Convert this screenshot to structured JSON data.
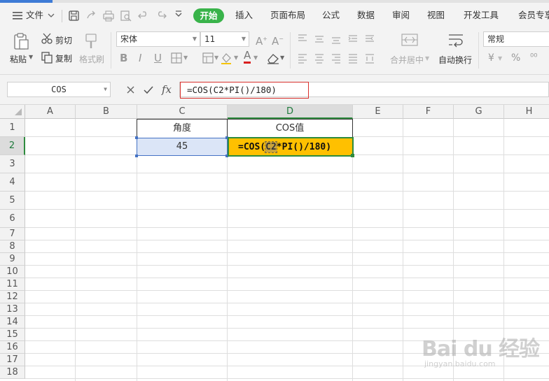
{
  "menu": {
    "file_label": "文件",
    "tabs": [
      "开始",
      "插入",
      "页面布局",
      "公式",
      "数据",
      "审阅",
      "视图",
      "开发工具",
      "会员专享"
    ]
  },
  "ribbon": {
    "paste": "粘贴",
    "cut": "剪切",
    "copy": "复制",
    "format_painter": "格式刷",
    "font_name": "宋体",
    "font_size": "11",
    "merge_center": "合并居中",
    "wrap_text": "自动换行",
    "number_format": "常规",
    "currency_symbol": "¥",
    "percent_symbol": "%"
  },
  "formula_bar": {
    "name_box": "COS",
    "fx_label": "fx",
    "formula": "=COS(C2*PI()/180)"
  },
  "grid": {
    "columns": [
      "A",
      "B",
      "C",
      "D",
      "E",
      "F",
      "G",
      "H"
    ],
    "rows": [
      "1",
      "2",
      "3",
      "4",
      "5",
      "6",
      "7",
      "8",
      "9",
      "10",
      "11",
      "12",
      "13",
      "14",
      "15",
      "16",
      "17",
      "18"
    ],
    "active_column": "D",
    "active_row": "2",
    "cells": {
      "C1": "角度",
      "D1": "COS值",
      "C2": "45",
      "D2_prefix": "=COS(",
      "D2_ref": "C2",
      "D2_suffix": "*PI()/180)"
    }
  },
  "colors": {
    "accent_green": "#39b34a",
    "edit_cell_fill": "#ffc000",
    "ref_cell_fill": "#dbe5f7",
    "ref_border": "#4472c4",
    "formula_highlight": "#d9302c"
  },
  "watermark": {
    "brand": "Bai du 经验",
    "url": "jingyan.baidu.com"
  }
}
